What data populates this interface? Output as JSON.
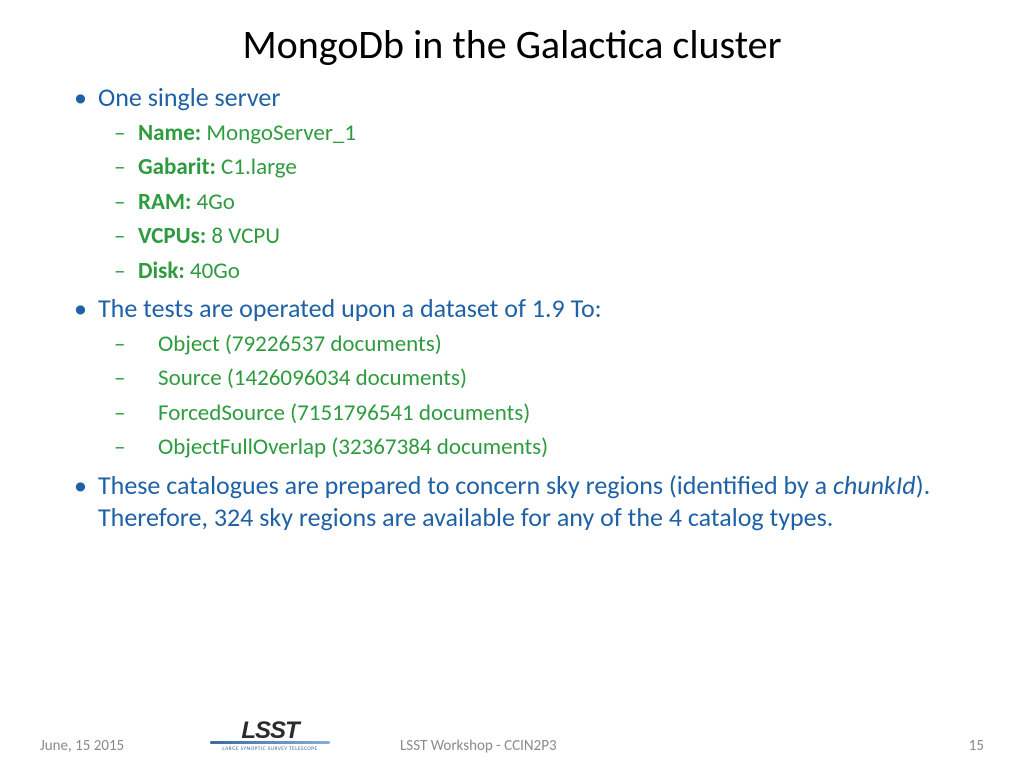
{
  "title": "MongoDb in the Galactica cluster",
  "bullets": {
    "b1": "One single server",
    "server": {
      "name_label": "Name:",
      "name_val": " MongoServer_1",
      "gabarit_label": "Gabarit:",
      "gabarit_val": " C1.large",
      "ram_label": "RAM:",
      "ram_val": " 4Go",
      "vcpu_label": "VCPUs:",
      "vcpu_val": " 8 VCPU",
      "disk_label": "Disk:",
      "disk_val": " 40Go"
    },
    "b2": "The tests are operated upon a dataset of 1.9 To:",
    "dataset": {
      "d1": "Object (79226537 documents)",
      "d2": "Source (1426096034 documents)",
      "d3": "ForcedSource (7151796541 documents)",
      "d4": "ObjectFullOverlap (32367384 documents)"
    },
    "b3a": "These catalogues are prepared to concern sky regions (identified by a ",
    "b3b": "chunkId",
    "b3c": "). Therefore, 324 sky regions are available for any of the 4 catalog types."
  },
  "footer": {
    "date": "June, 15 2015",
    "center": "LSST Workshop - CCIN2P3",
    "page": "15",
    "logo_main": "LSST",
    "logo_sub": "LARGE SYNOPTIC SURVEY TELESCOPE"
  }
}
